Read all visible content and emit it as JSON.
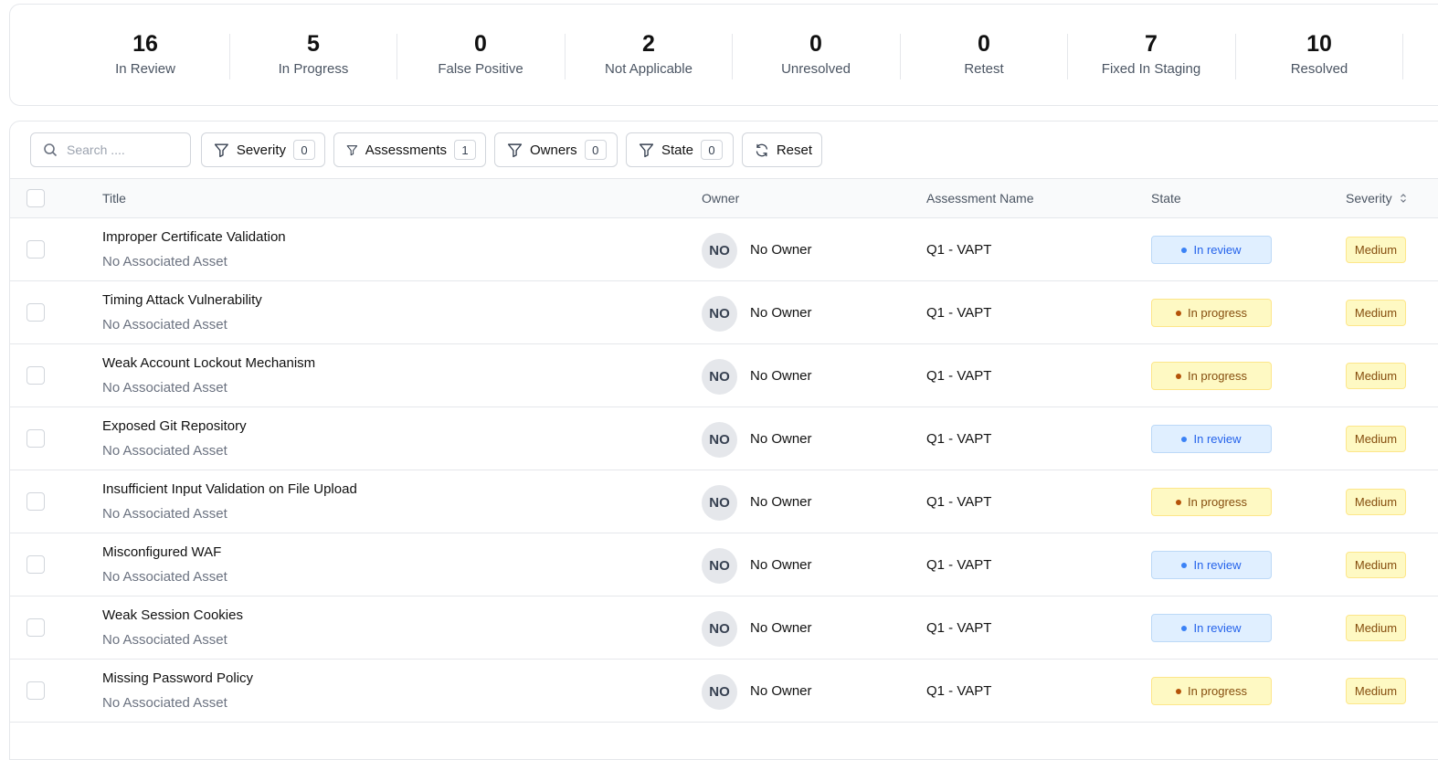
{
  "stats": [
    {
      "value": "16",
      "label": "In Review"
    },
    {
      "value": "5",
      "label": "In Progress"
    },
    {
      "value": "0",
      "label": "False Positive"
    },
    {
      "value": "2",
      "label": "Not Applicable"
    },
    {
      "value": "0",
      "label": "Unresolved"
    },
    {
      "value": "0",
      "label": "Retest"
    },
    {
      "value": "7",
      "label": "Fixed In Staging"
    },
    {
      "value": "10",
      "label": "Resolved"
    }
  ],
  "toolbar": {
    "search_placeholder": "Search ....",
    "filters": [
      {
        "label": "Severity",
        "count": "0"
      },
      {
        "label": "Assessments",
        "count": "1"
      },
      {
        "label": "Owners",
        "count": "0"
      },
      {
        "label": "State",
        "count": "0"
      }
    ],
    "reset_label": "Reset"
  },
  "table": {
    "columns": {
      "title": "Title",
      "owner": "Owner",
      "assessment": "Assessment Name",
      "state": "State",
      "severity": "Severity"
    },
    "rows": [
      {
        "title": "Improper Certificate Validation",
        "asset": "No Associated Asset",
        "owner_initials": "NO",
        "owner": "No Owner",
        "assessment": "Q1 - VAPT",
        "state": "In review",
        "severity": "Medium"
      },
      {
        "title": "Timing Attack Vulnerability",
        "asset": "No Associated Asset",
        "owner_initials": "NO",
        "owner": "No Owner",
        "assessment": "Q1 - VAPT",
        "state": "In progress",
        "severity": "Medium"
      },
      {
        "title": "Weak Account Lockout Mechanism",
        "asset": "No Associated Asset",
        "owner_initials": "NO",
        "owner": "No Owner",
        "assessment": "Q1 - VAPT",
        "state": "In progress",
        "severity": "Medium"
      },
      {
        "title": "Exposed Git Repository",
        "asset": "No Associated Asset",
        "owner_initials": "NO",
        "owner": "No Owner",
        "assessment": "Q1 - VAPT",
        "state": "In review",
        "severity": "Medium"
      },
      {
        "title": "Insufficient Input Validation on File Upload",
        "asset": "No Associated Asset",
        "owner_initials": "NO",
        "owner": "No Owner",
        "assessment": "Q1 - VAPT",
        "state": "In progress",
        "severity": "Medium"
      },
      {
        "title": "Misconfigured WAF",
        "asset": "No Associated Asset",
        "owner_initials": "NO",
        "owner": "No Owner",
        "assessment": "Q1 - VAPT",
        "state": "In review",
        "severity": "Medium"
      },
      {
        "title": "Weak Session Cookies",
        "asset": "No Associated Asset",
        "owner_initials": "NO",
        "owner": "No Owner",
        "assessment": "Q1 - VAPT",
        "state": "In review",
        "severity": "Medium"
      },
      {
        "title": "Missing Password Policy",
        "asset": "No Associated Asset",
        "owner_initials": "NO",
        "owner": "No Owner",
        "assessment": "Q1 - VAPT",
        "state": "In progress",
        "severity": "Medium"
      }
    ]
  }
}
